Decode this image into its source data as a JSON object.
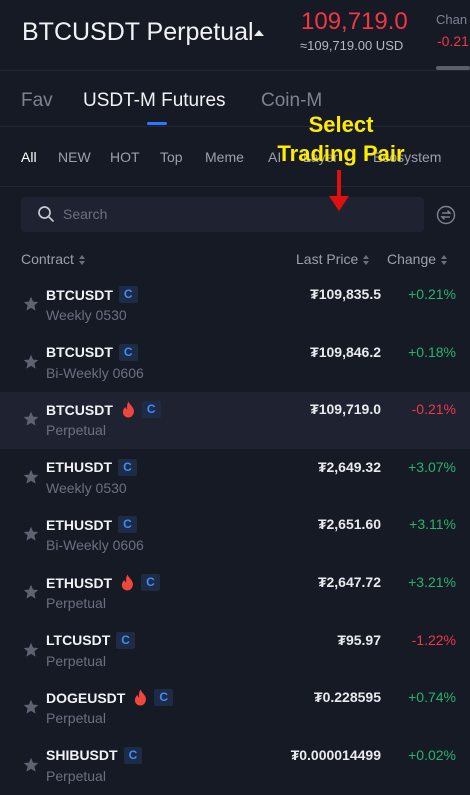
{
  "header": {
    "pair": "BTCUSDT Perpetual",
    "last_price": "109,719.0",
    "usd_price": "≈109,719.00 USD",
    "change_label": "Chan",
    "change": "-0.21",
    "price_color": "#f23645"
  },
  "tabs": [
    {
      "label": "Fav"
    },
    {
      "label": "USDT-M Futures"
    },
    {
      "label": "Coin-M"
    }
  ],
  "filters": [
    {
      "label": "All"
    },
    {
      "label": "NEW"
    },
    {
      "label": "HOT"
    },
    {
      "label": "Top"
    },
    {
      "label": "Meme"
    },
    {
      "label": "AI"
    },
    {
      "label": "Layer"
    },
    {
      "label": "Ecosystem"
    }
  ],
  "search": {
    "placeholder": "Search"
  },
  "columns": {
    "contract": "Contract",
    "last_price": "Last Price",
    "change": "Change"
  },
  "annotation": {
    "line1": "Select",
    "line2": "Trading Pair"
  },
  "rows": [
    {
      "symbol": "BTCUSDT",
      "badge": "C",
      "hot": false,
      "type": "Weekly 0530",
      "price": "₮109,835.5",
      "change": "+0.21%",
      "direction": "up"
    },
    {
      "symbol": "BTCUSDT",
      "badge": "C",
      "hot": false,
      "type": "Bi-Weekly 0606",
      "price": "₮109,846.2",
      "change": "+0.18%",
      "direction": "up"
    },
    {
      "symbol": "BTCUSDT",
      "badge": "C",
      "hot": true,
      "type": "Perpetual",
      "price": "₮109,719.0",
      "change": "-0.21%",
      "direction": "down",
      "selected": true
    },
    {
      "symbol": "ETHUSDT",
      "badge": "C",
      "hot": false,
      "type": "Weekly 0530",
      "price": "₮2,649.32",
      "change": "+3.07%",
      "direction": "up"
    },
    {
      "symbol": "ETHUSDT",
      "badge": "C",
      "hot": false,
      "type": "Bi-Weekly 0606",
      "price": "₮2,651.60",
      "change": "+3.11%",
      "direction": "up"
    },
    {
      "symbol": "ETHUSDT",
      "badge": "C",
      "hot": true,
      "type": "Perpetual",
      "price": "₮2,647.72",
      "change": "+3.21%",
      "direction": "up"
    },
    {
      "symbol": "LTCUSDT",
      "badge": "C",
      "hot": false,
      "type": "Perpetual",
      "price": "₮95.97",
      "change": "-1.22%",
      "direction": "down"
    },
    {
      "symbol": "DOGEUSDT",
      "badge": "C",
      "hot": true,
      "type": "Perpetual",
      "price": "₮0.228595",
      "change": "+0.74%",
      "direction": "up"
    },
    {
      "symbol": "SHIBUSDT",
      "badge": "C",
      "hot": false,
      "type": "Perpetual",
      "price": "₮0.000014499",
      "change": "+0.02%",
      "direction": "up"
    }
  ],
  "colors": {
    "accent": "#2b78ff",
    "up": "#26b36b",
    "down": "#f23645",
    "annotation": "#ffea00"
  }
}
